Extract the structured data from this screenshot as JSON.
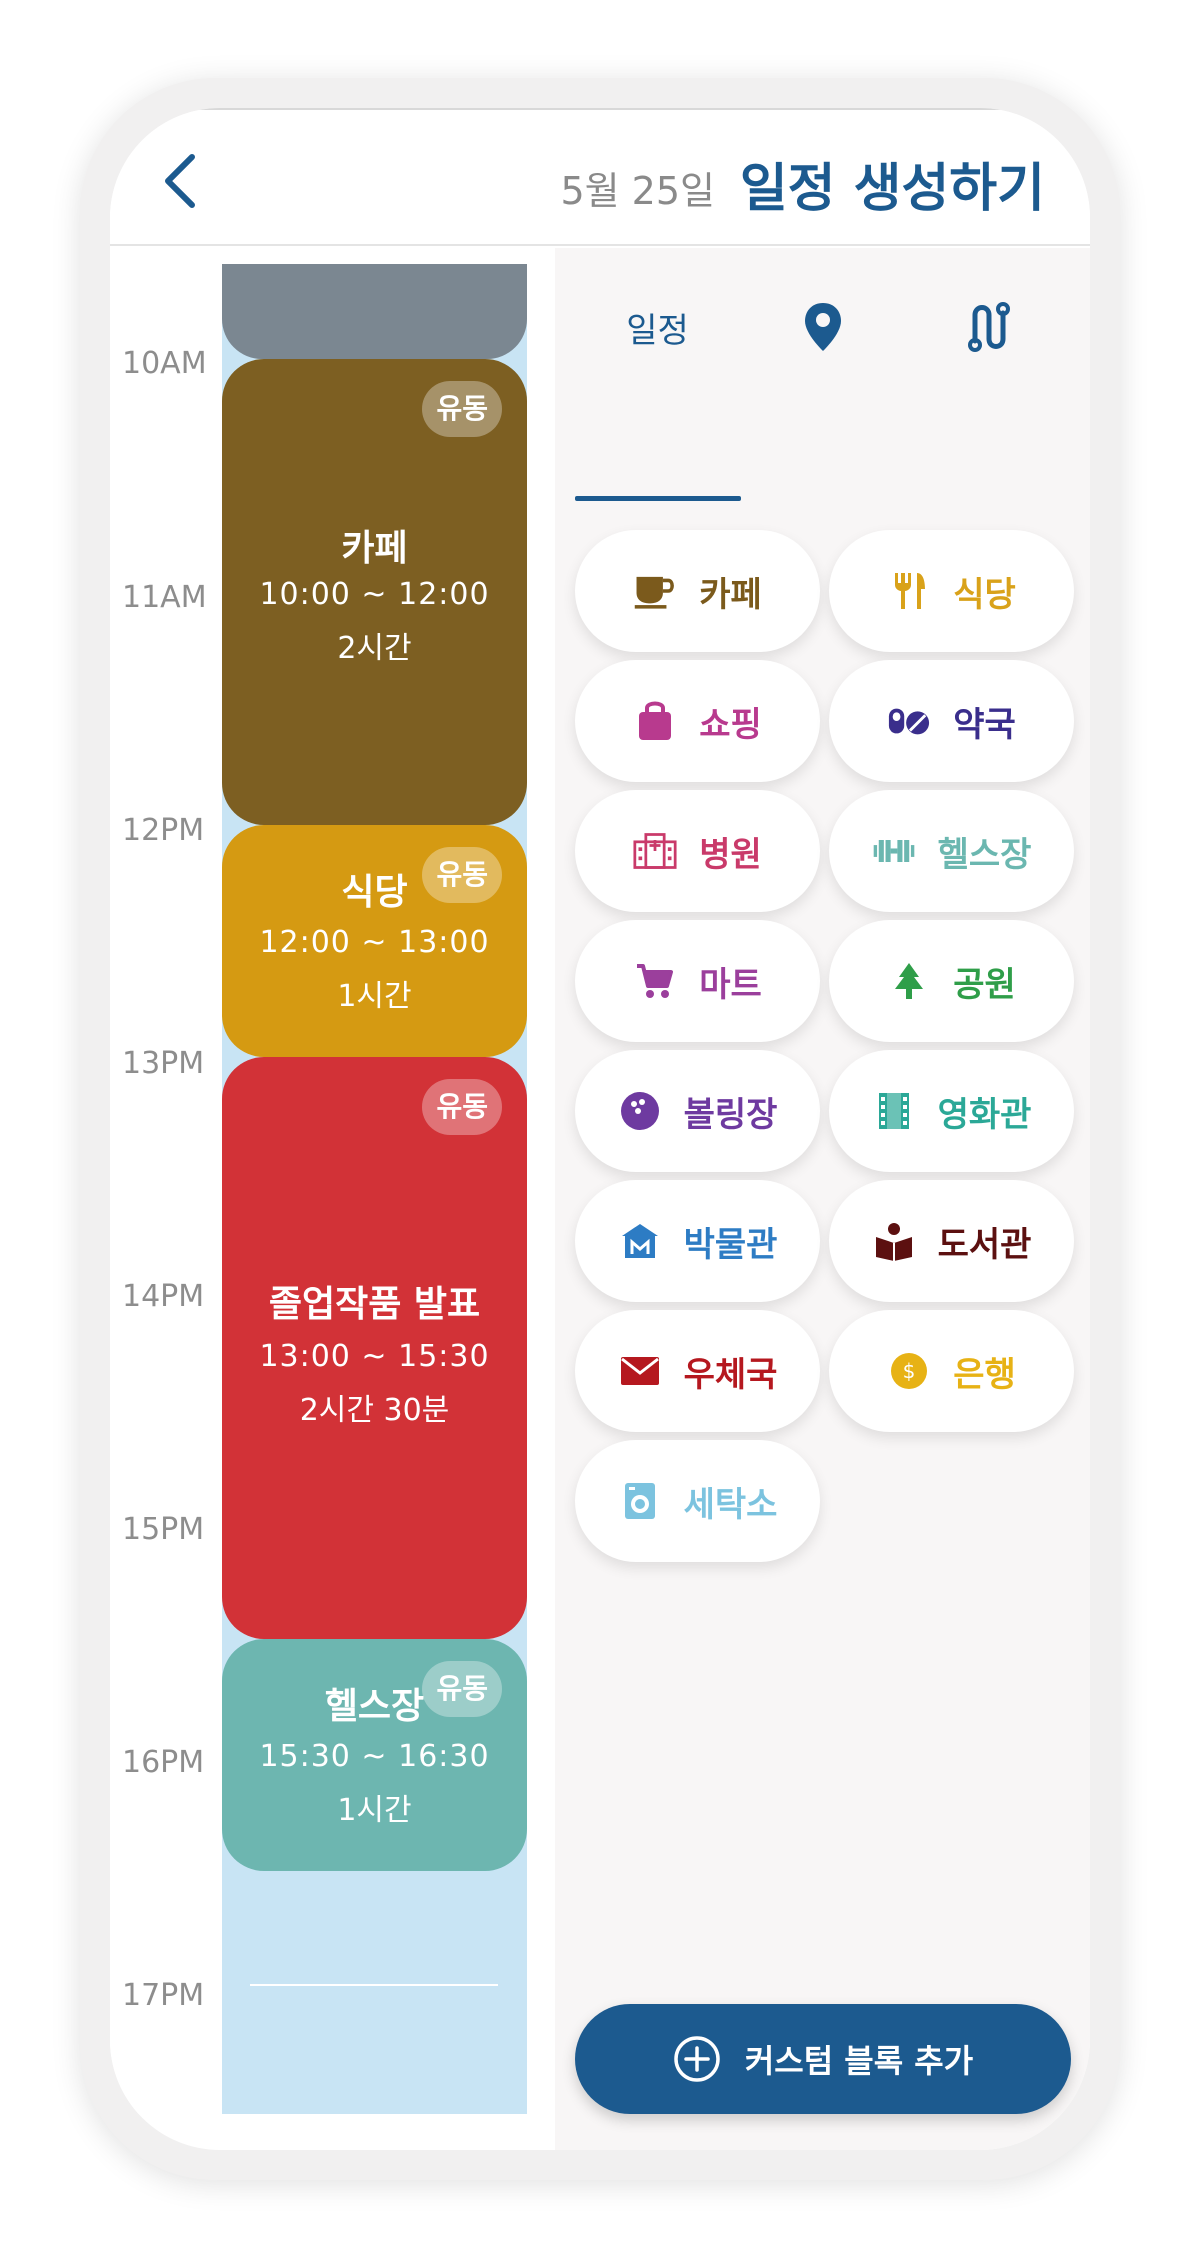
{
  "header": {
    "date": "5월 25일",
    "title": "일정 생성하기",
    "back_icon": "chevron-left-icon"
  },
  "timeline": {
    "hours": [
      "10AM",
      "11AM",
      "12PM",
      "13PM",
      "14PM",
      "15PM",
      "16PM",
      "17PM"
    ],
    "blocks": [
      {
        "title": "카페",
        "time": "10:00 ~ 12:00",
        "duration": "2시간",
        "badge": "유동",
        "color": "#7d5f22"
      },
      {
        "title": "식당",
        "time": "12:00 ~ 13:00",
        "duration": "1시간",
        "badge": "유동",
        "color": "#d59a12"
      },
      {
        "title": "졸업작품 발표",
        "time": "13:00 ~ 15:30",
        "duration": "2시간 30분",
        "badge": "유동",
        "color": "#d23237"
      },
      {
        "title": "헬스장",
        "time": "15:30 ~ 16:30",
        "duration": "1시간",
        "badge": "유동",
        "color": "#6db6b0"
      }
    ]
  },
  "tabs": [
    {
      "label": "일정",
      "active": true
    },
    {
      "icon": "location-pin-icon"
    },
    {
      "icon": "route-icon"
    }
  ],
  "categories": [
    {
      "label": "카페",
      "icon": "coffee-cup-icon",
      "color": "#7b5a1c"
    },
    {
      "label": "식당",
      "icon": "fork-knife-icon",
      "color": "#d9a21a"
    },
    {
      "label": "쇼핑",
      "icon": "shopping-bag-icon",
      "color": "#b83a8e"
    },
    {
      "label": "약국",
      "icon": "pill-icon",
      "color": "#3a2e8c"
    },
    {
      "label": "병원",
      "icon": "hospital-icon",
      "color": "#c93a6a"
    },
    {
      "label": "헬스장",
      "icon": "dumbbell-icon",
      "color": "#6bb7b0"
    },
    {
      "label": "마트",
      "icon": "shopping-cart-icon",
      "color": "#9b3f9c"
    },
    {
      "label": "공원",
      "icon": "tree-icon",
      "color": "#2f9e49"
    },
    {
      "label": "볼링장",
      "icon": "bowling-ball-icon",
      "color": "#6e3aa0"
    },
    {
      "label": "영화관",
      "icon": "film-icon",
      "color": "#2ba897"
    },
    {
      "label": "박물관",
      "icon": "museum-icon",
      "color": "#2d7cc4"
    },
    {
      "label": "도서관",
      "icon": "reading-book-icon",
      "color": "#5c1010"
    },
    {
      "label": "우체국",
      "icon": "mail-icon",
      "color": "#b5181f"
    },
    {
      "label": "은행",
      "icon": "coin-icon",
      "color": "#e7b215"
    },
    {
      "label": "세탁소",
      "icon": "washing-machine-icon",
      "color": "#7cc3df"
    }
  ],
  "add_button": {
    "label": "커스텀 블록 추가",
    "icon": "plus-circle-icon"
  }
}
